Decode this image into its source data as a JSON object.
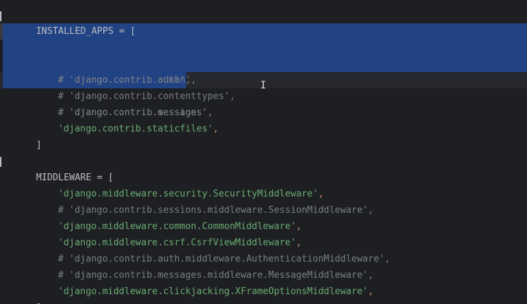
{
  "editor": {
    "lines": [
      {
        "kind": "plain",
        "text": "INSTALLED_APPS = ["
      },
      {
        "kind": "comment",
        "text": "# 'django.contrib.admin',",
        "selected": "full"
      },
      {
        "kind": "comment",
        "text": "# 'django.contrib.auth',",
        "selected": "full"
      },
      {
        "kind": "comment",
        "text": "# 'django.contrib.contenttypes',",
        "selected": "full"
      },
      {
        "kind": "comment",
        "text": "# 'django.contrib.sessions',",
        "selected": "partial"
      },
      {
        "kind": "comment",
        "text": "# 'django.contrib.messages',"
      },
      {
        "kind": "string",
        "text": "'django.contrib.staticfiles'",
        "comma": ","
      },
      {
        "kind": "plain",
        "text": "]"
      },
      {
        "kind": "blank",
        "text": ""
      },
      {
        "kind": "plain",
        "text": "MIDDLEWARE = ["
      },
      {
        "kind": "string",
        "text": "'django.middleware.security.SecurityMiddleware'",
        "comma": ","
      },
      {
        "kind": "comment",
        "text": "# 'django.contrib.sessions.middleware.SessionMiddleware',"
      },
      {
        "kind": "string",
        "text": "'django.middleware.common.CommonMiddleware'",
        "comma": ","
      },
      {
        "kind": "string",
        "text": "'django.middleware.csrf.CsrfViewMiddleware'",
        "comma": ","
      },
      {
        "kind": "comment",
        "text": "# 'django.contrib.auth.middleware.AuthenticationMiddleware',"
      },
      {
        "kind": "comment",
        "text": "# 'django.contrib.messages.middleware.MessageMiddleware',"
      },
      {
        "kind": "string",
        "text": "'django.middleware.clickjacking.XFrameOptionsMiddleware'",
        "comma": ","
      },
      {
        "kind": "plain",
        "text": "]"
      }
    ]
  },
  "colors": {
    "background": "#1e1f22",
    "selection": "#214283",
    "comment": "#7a7e85",
    "string": "#6aab73",
    "punctuation": "#cf8e6d",
    "text": "#bcbec4"
  },
  "cursor": {
    "icon": "text-cursor-icon",
    "glyph": "I"
  }
}
